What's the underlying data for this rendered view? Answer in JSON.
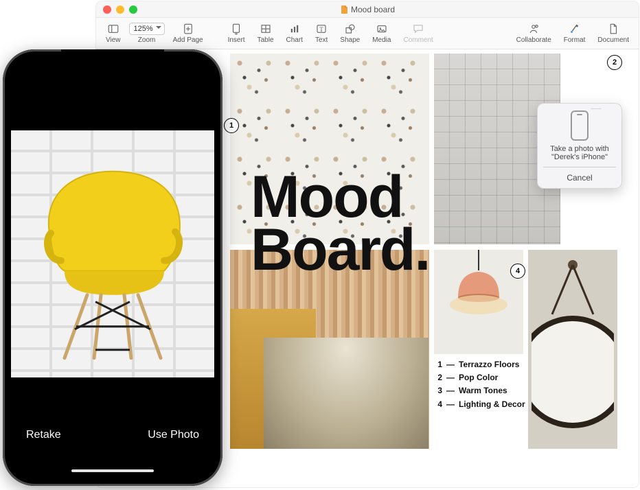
{
  "mac": {
    "window_title": "Mood board",
    "toolbar": {
      "view": "View",
      "zoom_value": "125%",
      "zoom_label": "Zoom",
      "add_page": "Add Page",
      "insert": "Insert",
      "table": "Table",
      "chart": "Chart",
      "text": "Text",
      "shape": "Shape",
      "media": "Media",
      "comment": "Comment",
      "collaborate": "Collaborate",
      "format": "Format",
      "document": "Document"
    },
    "popover": {
      "line1": "Take a photo with",
      "line2": "\"Derek's iPhone\"",
      "cancel": "Cancel"
    }
  },
  "doc": {
    "headline_l1": "Mood",
    "headline_l2": "Board.",
    "badges": {
      "b1": "1",
      "b2": "2",
      "b4": "4"
    },
    "legend": [
      {
        "n": "1",
        "label": "Terrazzo Floors"
      },
      {
        "n": "2",
        "label": "Pop Color"
      },
      {
        "n": "3",
        "label": "Warm Tones"
      },
      {
        "n": "4",
        "label": "Lighting & Decor"
      }
    ]
  },
  "phone": {
    "retake": "Retake",
    "use_photo": "Use Photo"
  }
}
